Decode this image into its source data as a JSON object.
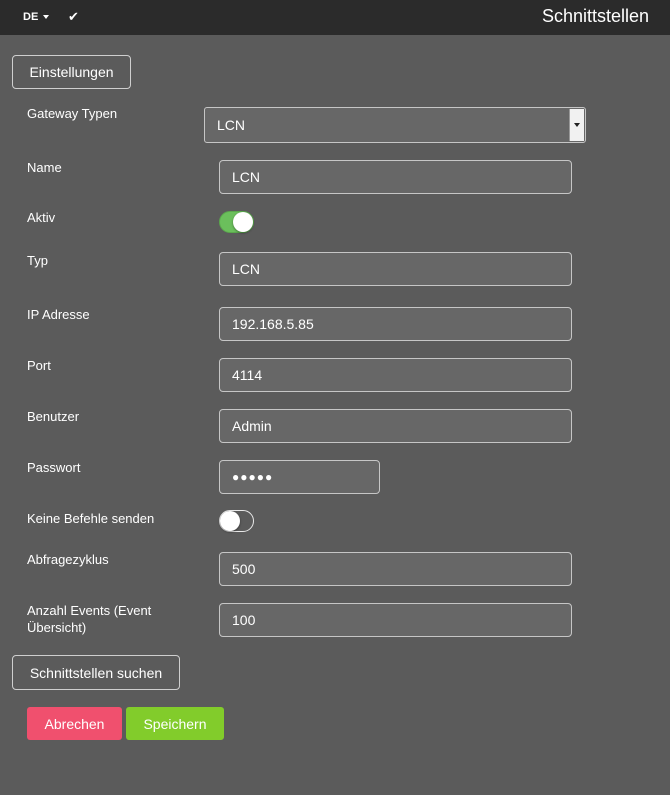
{
  "topbar": {
    "language": "DE",
    "title": "Schnittstellen"
  },
  "settings_button": "Einstellungen",
  "search_button": "Schnittstellen suchen",
  "form": {
    "gateway_type": {
      "label": "Gateway Typen",
      "value": "LCN"
    },
    "name": {
      "label": "Name",
      "value": "LCN"
    },
    "active": {
      "label": "Aktiv",
      "on": true
    },
    "type": {
      "label": "Typ",
      "value": "LCN"
    },
    "ip": {
      "label": "IP Adresse",
      "value": "192.168.5.85"
    },
    "port": {
      "label": "Port",
      "value": "4114"
    },
    "user": {
      "label": "Benutzer",
      "value": "Admin"
    },
    "password": {
      "label": "Passwort",
      "value": "●●●●●"
    },
    "no_commands": {
      "label": "Keine Befehle senden",
      "on": false
    },
    "poll_cycle": {
      "label": "Abfragezyklus",
      "value": "500"
    },
    "event_count": {
      "label_line1": "Anzahl Events (Event",
      "label_line2": "Übersicht)",
      "value": "100"
    }
  },
  "actions": {
    "cancel": "Abrechen",
    "save": "Speichern"
  },
  "colors": {
    "topbar": "#2b2b2b",
    "background": "#5b5b5b",
    "cancel": "#f0506e",
    "save": "#82cc2b",
    "toggle_on": "#6bbf5c"
  },
  "icons": {
    "language_caret": "chevron-down-icon",
    "check": "check-icon"
  }
}
